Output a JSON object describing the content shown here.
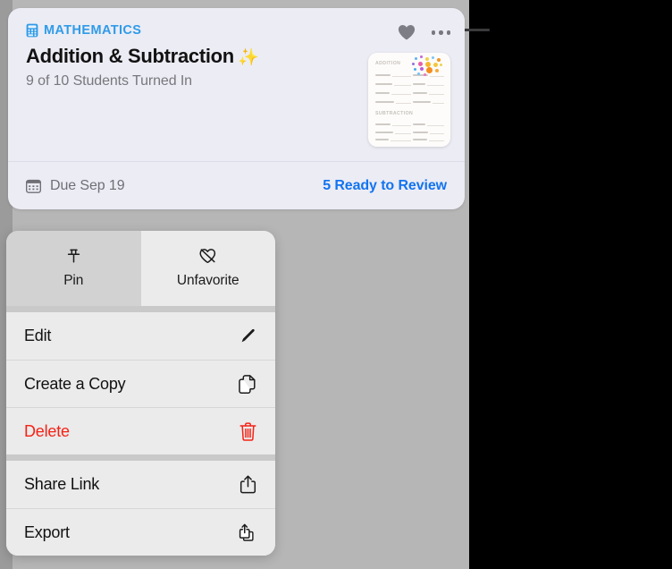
{
  "card": {
    "subject": "MATHEMATICS",
    "subject_icon": "calculator-icon",
    "title": "Addition & Subtraction",
    "title_emoji": "✨",
    "subtitle": "9 of 10 Students Turned In",
    "favorite_icon": "heart-filled-icon",
    "more_icon": "ellipsis-icon",
    "due_icon": "calendar-icon",
    "due_text": "Due Sep 19",
    "review_link": "5 Ready to Review",
    "accent_color": "#1274f0",
    "subject_color": "#2f9be8",
    "card_background": "#ececf5"
  },
  "thumbnail": {
    "name": "worksheet-thumbnail",
    "section_one": "ADDITION",
    "section_two": "SUBTRACTION"
  },
  "context_menu": {
    "tabs": [
      {
        "label": "Pin",
        "icon": "pin-icon",
        "state": "pressed"
      },
      {
        "label": "Unfavorite",
        "icon": "heart-slash-icon",
        "state": "normal"
      }
    ],
    "groups": [
      {
        "rows": [
          {
            "label": "Edit",
            "icon": "pencil-icon",
            "destructive": false
          },
          {
            "label": "Create a Copy",
            "icon": "duplicate-icon",
            "destructive": false
          },
          {
            "label": "Delete",
            "icon": "trash-icon",
            "destructive": true
          }
        ]
      },
      {
        "rows": [
          {
            "label": "Share Link",
            "icon": "share-icon",
            "destructive": false
          },
          {
            "label": "Export",
            "icon": "export-icon",
            "destructive": false
          }
        ]
      }
    ],
    "destructive_color": "#f52216"
  }
}
